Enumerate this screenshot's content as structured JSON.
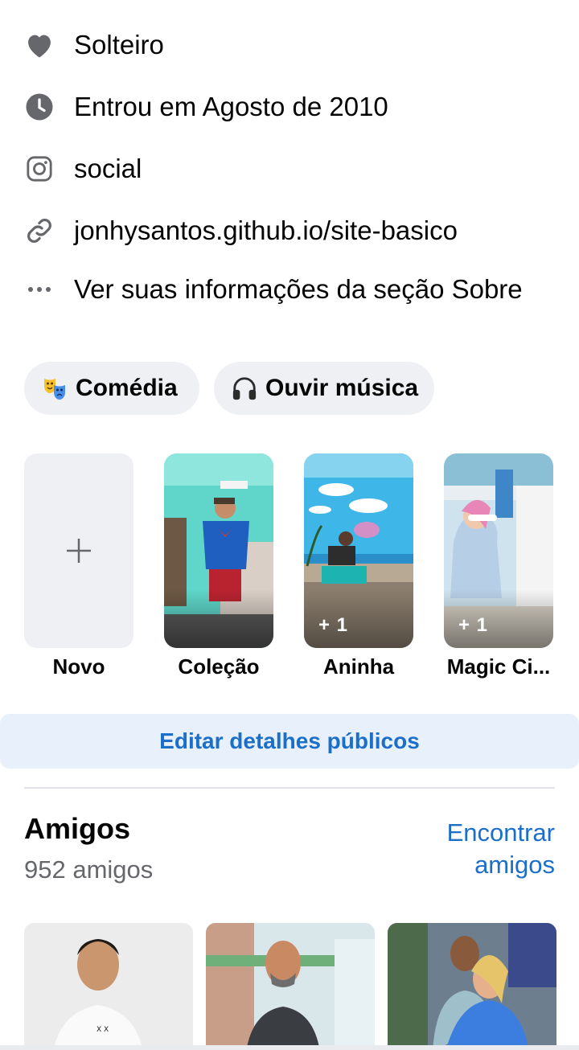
{
  "info": [
    {
      "icon": "heart-icon",
      "text": "Solteiro"
    },
    {
      "icon": "clock-icon",
      "text": "Entrou em Agosto de 2010"
    },
    {
      "icon": "instagram-icon",
      "text": "social"
    },
    {
      "icon": "link-icon",
      "text": "jonhysantos.github.io/site-basico"
    },
    {
      "icon": "more-icon",
      "text": "Ver suas informações da seção Sobre"
    }
  ],
  "hobbies": [
    {
      "icon": "theater-masks-icon",
      "label": "Comédia"
    },
    {
      "icon": "headphones-icon",
      "label": "Ouvir música"
    }
  ],
  "featured": {
    "new_label": "Novo",
    "items": [
      {
        "label": "Coleção",
        "count": ""
      },
      {
        "label": "Aninha",
        "count": "+ 1"
      },
      {
        "label": "Magic Ci...",
        "count": "+ 1"
      }
    ]
  },
  "edit_button": "Editar detalhes públicos",
  "friends": {
    "title": "Amigos",
    "count": "952 amigos",
    "find_line1": "Encontrar",
    "find_line2": "amigos"
  },
  "colors": {
    "accent": "#1b6fc9",
    "chip_bg": "#eef0f3",
    "edit_bg": "#e7f0fb",
    "icon_gray": "#65676b"
  }
}
